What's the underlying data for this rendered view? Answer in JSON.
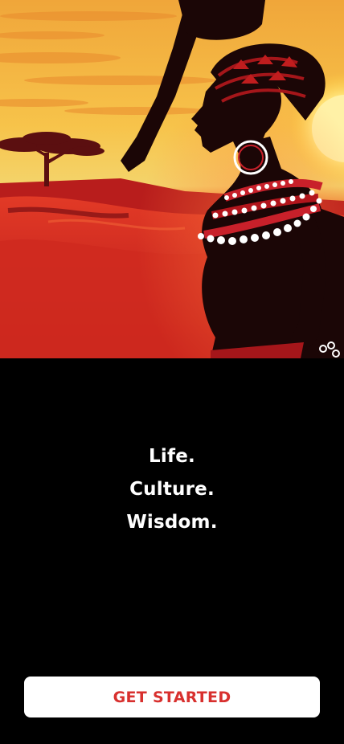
{
  "hero": {
    "illustration_icon": "african-woman-sunset-illustration"
  },
  "tagline": {
    "lines": [
      "Life.",
      "Culture.",
      "Wisdom."
    ]
  },
  "cta": {
    "label": "GET STARTED"
  },
  "colors": {
    "background": "#000000",
    "accent": "#d8302e",
    "button_bg": "#ffffff",
    "text": "#ffffff"
  }
}
